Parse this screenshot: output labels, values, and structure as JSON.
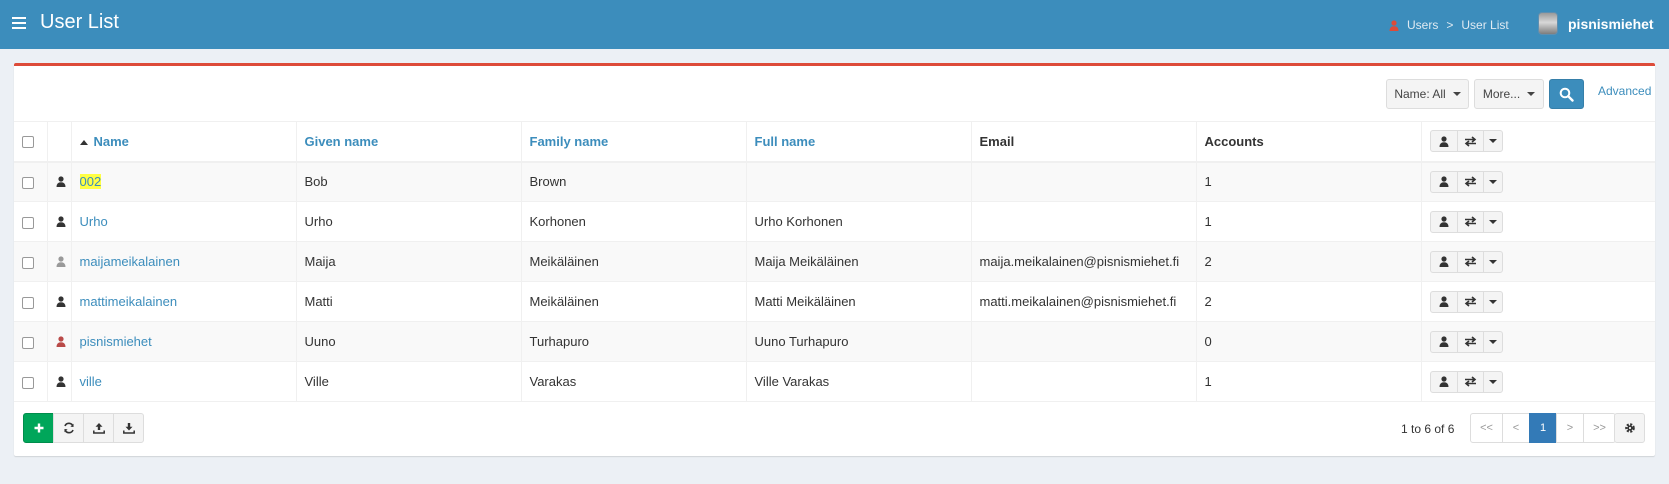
{
  "header": {
    "title": "User List",
    "breadcrumb": [
      "Users",
      "User List"
    ],
    "breadcrumb_separator": ">",
    "user_name": "pisnismiehet"
  },
  "filters": {
    "name_filter_label": "Name: All",
    "more_label": "More...",
    "advanced_label": "Advanced"
  },
  "table": {
    "columns": [
      "Name",
      "Given name",
      "Family name",
      "Full name",
      "Email",
      "Accounts"
    ],
    "rows": [
      {
        "name": "002",
        "given": "Bob",
        "family": "Brown",
        "full": "",
        "email": "",
        "accounts": "1",
        "icon_color": "#333333",
        "highlight": true
      },
      {
        "name": "Urho",
        "given": "Urho",
        "family": "Korhonen",
        "full": "Urho Korhonen",
        "email": "",
        "accounts": "1",
        "icon_color": "#333333",
        "highlight": false
      },
      {
        "name": "maijameikalainen",
        "given": "Maija",
        "family": "Meikäläinen",
        "full": "Maija Meikäläinen",
        "email": "maija.meikalainen@pisnismiehet.fi",
        "accounts": "2",
        "icon_color": "#999999",
        "highlight": false
      },
      {
        "name": "mattimeikalainen",
        "given": "Matti",
        "family": "Meikäläinen",
        "full": "Matti Meikäläinen",
        "email": "matti.meikalainen@pisnismiehet.fi",
        "accounts": "2",
        "icon_color": "#333333",
        "highlight": false
      },
      {
        "name": "pisnismiehet",
        "given": "Uuno",
        "family": "Turhapuro",
        "full": "Uuno Turhapuro",
        "email": "",
        "accounts": "0",
        "icon_color": "#b94a48",
        "highlight": false
      },
      {
        "name": "ville",
        "given": "Ville",
        "family": "Varakas",
        "full": "Ville Varakas",
        "email": "",
        "accounts": "1",
        "icon_color": "#333333",
        "highlight": false
      }
    ]
  },
  "footer": {
    "page_info": "1 to 6 of 6",
    "pagination": [
      "<<",
      "<",
      "1",
      ">",
      ">>"
    ],
    "current_page": "1"
  },
  "colors": {
    "header_bg": "#3c8dbc",
    "box_top_border": "#dd4b39",
    "link": "#3c8dbc",
    "add_button": "#00a65a",
    "highlight": "#ffff44"
  },
  "icons": {
    "menu": "hamburger-icon",
    "breadcrumb": "user-icon",
    "search": "search-icon",
    "row_user": "user-icon",
    "row_toggle": "exchange-icon",
    "add": "plus-icon",
    "refresh": "refresh-icon",
    "upload": "upload-icon",
    "download": "download-icon",
    "settings": "gear-icon"
  }
}
